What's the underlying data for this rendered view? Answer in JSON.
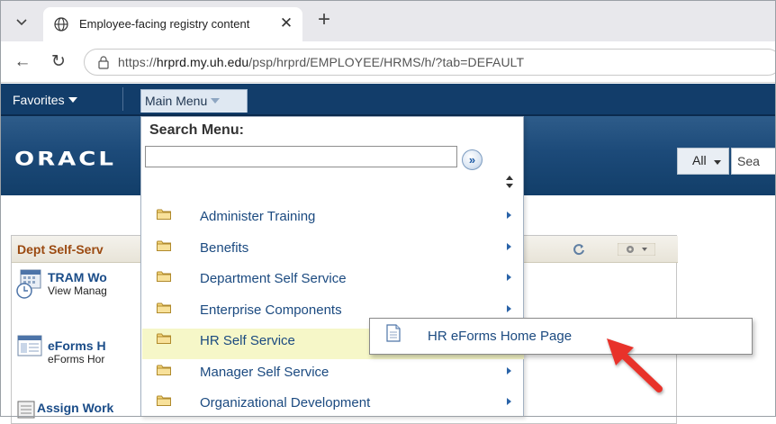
{
  "browser": {
    "tab_title": "Employee-facing registry content",
    "url_prefix": "https://",
    "url_host": "hrprd.my.uh.edu",
    "url_path": "/psp/hrprd/EMPLOYEE/HRMS/h/?tab=DEFAULT"
  },
  "navbar": {
    "favorites": "Favorites",
    "main_menu": "Main Menu"
  },
  "banner": {
    "logo": "ORACL",
    "search_scope": "All",
    "search_placeholder": "Sea"
  },
  "pagelet": {
    "title": "Dept Self-Serv",
    "items": [
      {
        "title": "TRAM Wo",
        "subtitle": "View Manag"
      },
      {
        "title": "eForms H",
        "subtitle": "eForms Hor"
      },
      {
        "title": "Assign Work",
        "subtitle": ""
      }
    ]
  },
  "main_menu_dropdown": {
    "search_label": "Search Menu:",
    "search_value": "",
    "go_glyph": "»",
    "items": [
      {
        "label": "Administer Training",
        "icon": "folder-icon",
        "highlighted": false
      },
      {
        "label": "Benefits",
        "icon": "folder-icon",
        "highlighted": false
      },
      {
        "label": "Department Self Service",
        "icon": "folder-icon",
        "highlighted": false
      },
      {
        "label": "Enterprise Components",
        "icon": "folder-icon",
        "highlighted": false
      },
      {
        "label": "HR Self Service",
        "icon": "folder-icon",
        "highlighted": true
      },
      {
        "label": "Manager Self Service",
        "icon": "folder-icon",
        "highlighted": false
      },
      {
        "label": "Organizational Development",
        "icon": "folder-icon",
        "highlighted": false
      }
    ]
  },
  "submenu": {
    "items": [
      {
        "label": "HR eForms Home Page",
        "icon": "document-icon"
      }
    ]
  },
  "colors": {
    "navbar": "#123d6a",
    "banner": "#1c4a79",
    "link": "#1b4a80",
    "highlight": "#f6f7c8",
    "pagelet_title": "#9b4a11",
    "annotation_arrow": "#e8332c"
  }
}
